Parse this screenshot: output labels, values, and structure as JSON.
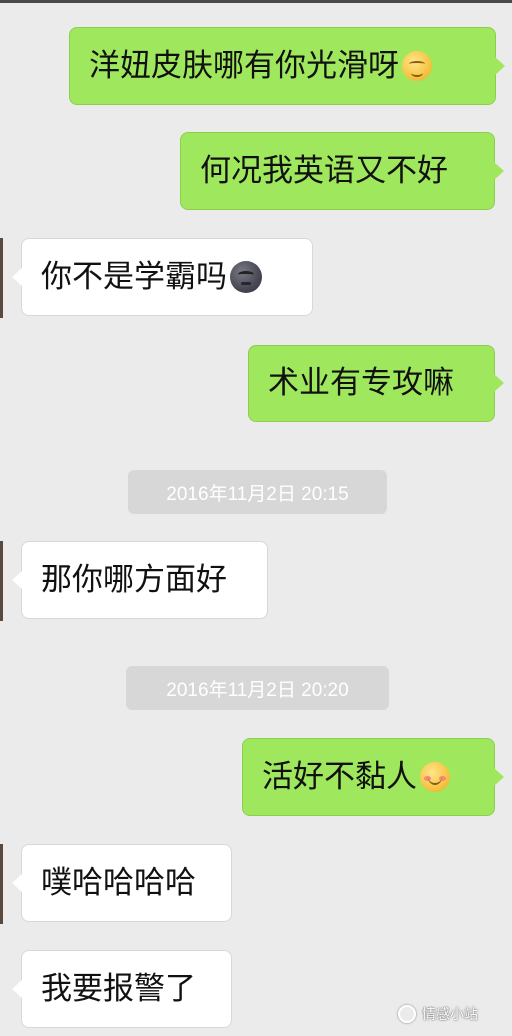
{
  "messages": [
    {
      "side": "out",
      "text": "洋妞皮肤哪有你光滑呀",
      "emoji": "smiling-hand-over-mouth-emoji"
    },
    {
      "side": "out",
      "text": "何况我英语又不好"
    },
    {
      "side": "in",
      "text": "你不是学霸吗",
      "emoji": "new-moon-face-emoji"
    },
    {
      "side": "out",
      "text": "术业有专攻嘛"
    },
    {
      "side": "in",
      "text": "那你哪方面好"
    },
    {
      "side": "out",
      "text": "活好不黏人",
      "emoji": "blushing-smile-emoji"
    },
    {
      "side": "in",
      "text": "噗哈哈哈哈"
    },
    {
      "side": "in",
      "text": "我要报警了"
    }
  ],
  "timestamps": [
    "2016年11月2日 20:15",
    "2016年11月2日 20:20"
  ],
  "watermark": {
    "text": "情感小站",
    "icon": "wechat-channel-icon"
  },
  "colors": {
    "background": "#ebebeb",
    "outgoing_bubble": "#9fe85d",
    "incoming_bubble": "#ffffff",
    "timestamp_bg": "#d7d7d7"
  }
}
